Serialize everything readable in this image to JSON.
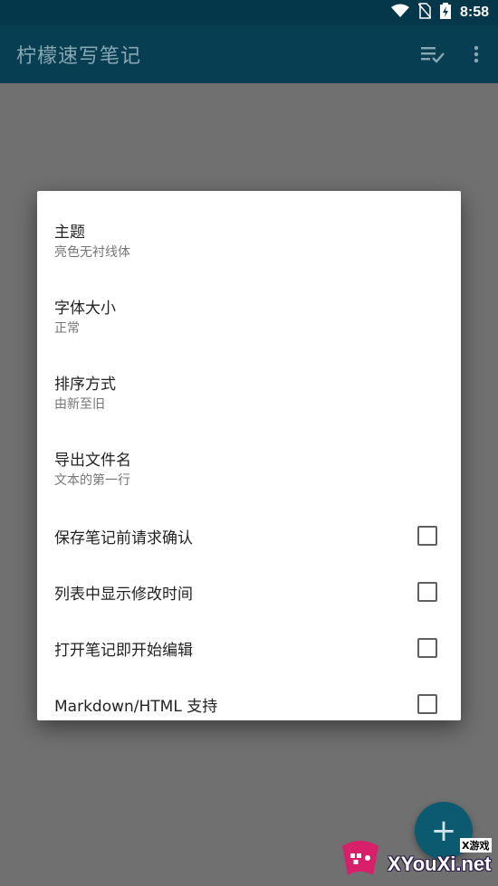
{
  "status_bar": {
    "time": "8:58",
    "icons": [
      "wifi-icon",
      "no-sim-icon",
      "battery-charging-icon"
    ]
  },
  "app_bar": {
    "title": "柠檬速写笔记",
    "actions": [
      "checklist-icon",
      "more-vert-icon"
    ]
  },
  "dialog": {
    "preferences": [
      {
        "title": "主题",
        "summary": "亮色无衬线体"
      },
      {
        "title": "字体大小",
        "summary": "正常"
      },
      {
        "title": "排序方式",
        "summary": "由新至旧"
      },
      {
        "title": "导出文件名",
        "summary": "文本的第一行"
      }
    ],
    "checkboxes": [
      {
        "label": "保存笔记前请求确认",
        "checked": false
      },
      {
        "label": "列表中显示修改时间",
        "checked": false
      },
      {
        "label": "打开笔记即开始编辑",
        "checked": false
      },
      {
        "label": "Markdown/HTML 支持",
        "checked": false
      }
    ]
  },
  "fab": {
    "icon": "add-icon",
    "glyph": "+"
  },
  "watermark": {
    "small_text": "X游戏",
    "brand_text": "XYouXi.net"
  },
  "colors": {
    "status_bar": "#04374a",
    "app_bar": "#073e51",
    "scrim": "#707070",
    "fab": "#0b5a70"
  }
}
